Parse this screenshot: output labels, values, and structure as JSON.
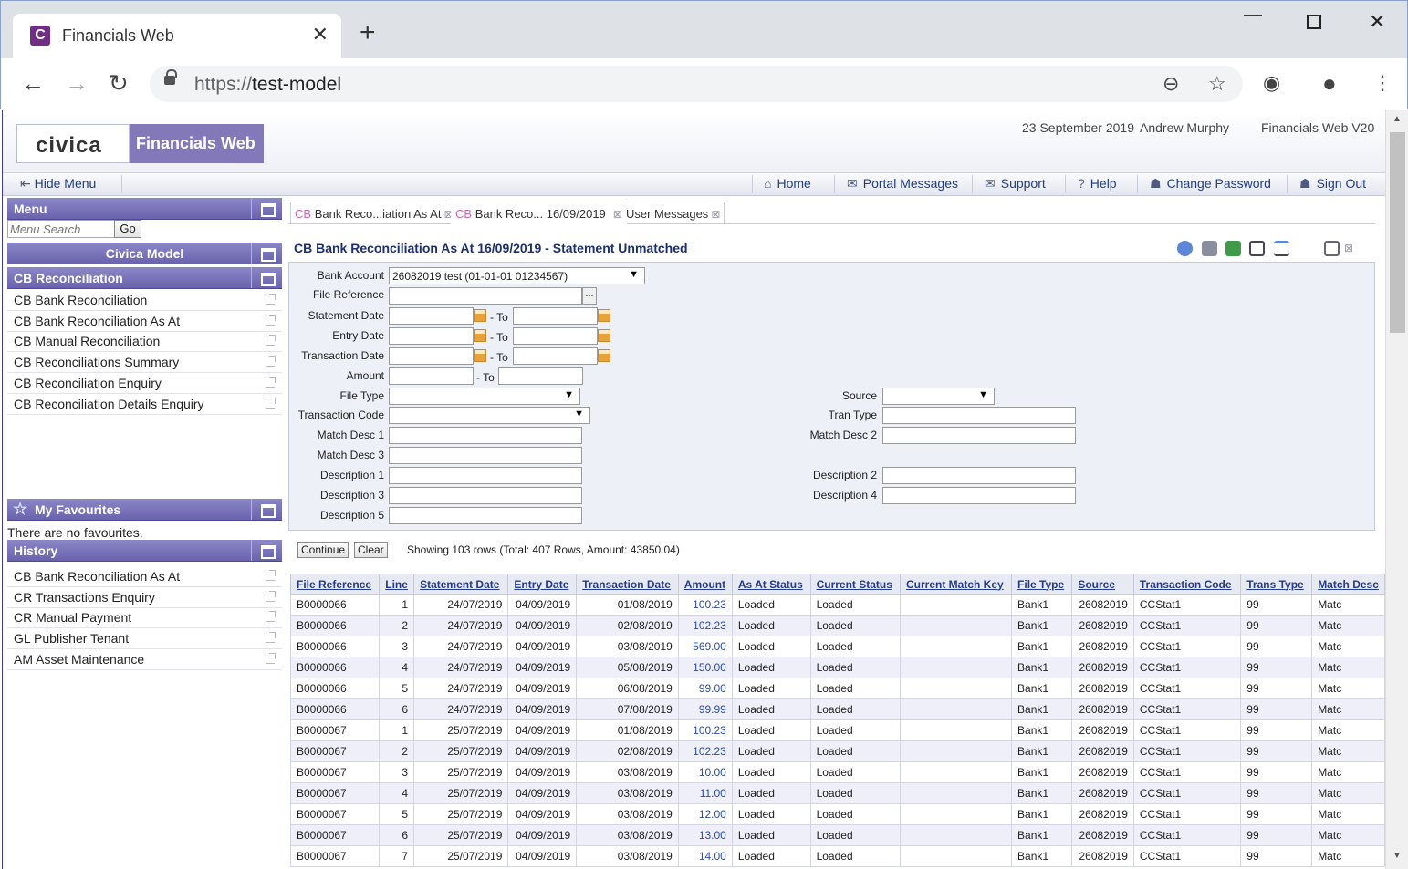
{
  "browser": {
    "tab_title": "Financials Web",
    "favicon_letter": "C",
    "url_scheme": "https://",
    "url_host": "test-model"
  },
  "header": {
    "logo": "civica",
    "product": "Financials Web",
    "date": "23 September 2019",
    "user": "Andrew Murphy",
    "version": "Financials Web V20"
  },
  "menubar": {
    "hide_menu": "Hide Menu",
    "links": [
      "Home",
      "Portal Messages",
      "Support",
      "Help",
      "Change Password",
      "Sign Out"
    ]
  },
  "sidebar": {
    "menu_title": "Menu",
    "search_placeholder": "Menu Search",
    "go": "Go",
    "model_title": "Civica Model",
    "section_title": "CB Reconciliation",
    "items": [
      "CB Bank Reconciliation",
      "CB Bank Reconciliation As At",
      "CB Manual Reconciliation",
      "CB Reconciliations Summary",
      "CB Reconciliation Enquiry",
      "CB Reconciliation Details Enquiry"
    ],
    "favourites_title": "My Favourites",
    "favourites_empty": "There are no favourites.",
    "history_title": "History",
    "history": [
      "CB Bank Reconciliation As At",
      "CR Transactions Enquiry",
      "CR Manual Payment",
      "GL Publisher Tenant",
      "AM Asset Maintenance"
    ]
  },
  "content_tabs": [
    {
      "prefix": "CB",
      "label": "Bank Reco...iation As At"
    },
    {
      "prefix": "CB",
      "label": "Bank Reco... 16/09/2019"
    },
    {
      "prefix": "",
      "label": "User Messages"
    }
  ],
  "form": {
    "title": "CB Bank Reconciliation As At 16/09/2019 - Statement Unmatched",
    "to": "- To",
    "labels": {
      "bank_account": "Bank Account",
      "file_reference": "File Reference",
      "statement_date": "Statement Date",
      "entry_date": "Entry Date",
      "transaction_date": "Transaction Date",
      "amount": "Amount",
      "file_type": "File Type",
      "transaction_code": "Transaction Code",
      "match_desc_1": "Match Desc 1",
      "match_desc_3": "Match Desc 3",
      "description_1": "Description 1",
      "description_3": "Description 3",
      "description_5": "Description 5",
      "source": "Source",
      "tran_type": "Tran Type",
      "match_desc_2": "Match Desc 2",
      "description_2": "Description 2",
      "description_4": "Description 4"
    },
    "bank_account_value": "26082019 test (01-01-01 01234567)",
    "ellipsis": "...",
    "continue": "Continue",
    "clear": "Clear",
    "showing": "Showing 103 rows (Total: 407 Rows, Amount: 43850.04)"
  },
  "grid": {
    "columns": [
      "File Reference",
      "Line",
      "Statement Date",
      "Entry Date",
      "Transaction Date",
      "Amount",
      "As At Status",
      "Current Status",
      "Current Match Key",
      "File Type",
      "Source",
      "Transaction Code",
      "Trans Type",
      "Match Desc"
    ],
    "rows": [
      [
        "B0000066",
        "1",
        "24/07/2019",
        "04/09/2019",
        "01/08/2019",
        "100.23",
        "Loaded",
        "Loaded",
        "",
        "Bank1",
        "26082019",
        "CCStat1",
        "99",
        "Matc"
      ],
      [
        "B0000066",
        "2",
        "24/07/2019",
        "04/09/2019",
        "02/08/2019",
        "102.23",
        "Loaded",
        "Loaded",
        "",
        "Bank1",
        "26082019",
        "CCStat1",
        "99",
        "Matc"
      ],
      [
        "B0000066",
        "3",
        "24/07/2019",
        "04/09/2019",
        "03/08/2019",
        "569.00",
        "Loaded",
        "Loaded",
        "",
        "Bank1",
        "26082019",
        "CCStat1",
        "99",
        "Matc"
      ],
      [
        "B0000066",
        "4",
        "24/07/2019",
        "04/09/2019",
        "05/08/2019",
        "150.00",
        "Loaded",
        "Loaded",
        "",
        "Bank1",
        "26082019",
        "CCStat1",
        "99",
        "Matc"
      ],
      [
        "B0000066",
        "5",
        "24/07/2019",
        "04/09/2019",
        "06/08/2019",
        "99.00",
        "Loaded",
        "Loaded",
        "",
        "Bank1",
        "26082019",
        "CCStat1",
        "99",
        "Matc"
      ],
      [
        "B0000066",
        "6",
        "24/07/2019",
        "04/09/2019",
        "07/08/2019",
        "99.99",
        "Loaded",
        "Loaded",
        "",
        "Bank1",
        "26082019",
        "CCStat1",
        "99",
        "Matc"
      ],
      [
        "B0000067",
        "1",
        "25/07/2019",
        "04/09/2019",
        "01/08/2019",
        "100.23",
        "Loaded",
        "Loaded",
        "",
        "Bank1",
        "26082019",
        "CCStat1",
        "99",
        "Matc"
      ],
      [
        "B0000067",
        "2",
        "25/07/2019",
        "04/09/2019",
        "02/08/2019",
        "102.23",
        "Loaded",
        "Loaded",
        "",
        "Bank1",
        "26082019",
        "CCStat1",
        "99",
        "Matc"
      ],
      [
        "B0000067",
        "3",
        "25/07/2019",
        "04/09/2019",
        "03/08/2019",
        "10.00",
        "Loaded",
        "Loaded",
        "",
        "Bank1",
        "26082019",
        "CCStat1",
        "99",
        "Matc"
      ],
      [
        "B0000067",
        "4",
        "25/07/2019",
        "04/09/2019",
        "03/08/2019",
        "11.00",
        "Loaded",
        "Loaded",
        "",
        "Bank1",
        "26082019",
        "CCStat1",
        "99",
        "Matc"
      ],
      [
        "B0000067",
        "5",
        "25/07/2019",
        "04/09/2019",
        "03/08/2019",
        "12.00",
        "Loaded",
        "Loaded",
        "",
        "Bank1",
        "26082019",
        "CCStat1",
        "99",
        "Matc"
      ],
      [
        "B0000067",
        "6",
        "25/07/2019",
        "04/09/2019",
        "03/08/2019",
        "13.00",
        "Loaded",
        "Loaded",
        "",
        "Bank1",
        "26082019",
        "CCStat1",
        "99",
        "Matc"
      ],
      [
        "B0000067",
        "7",
        "25/07/2019",
        "04/09/2019",
        "03/08/2019",
        "14.00",
        "Loaded",
        "Loaded",
        "",
        "Bank1",
        "26082019",
        "CCStat1",
        "99",
        "Matc"
      ]
    ]
  }
}
